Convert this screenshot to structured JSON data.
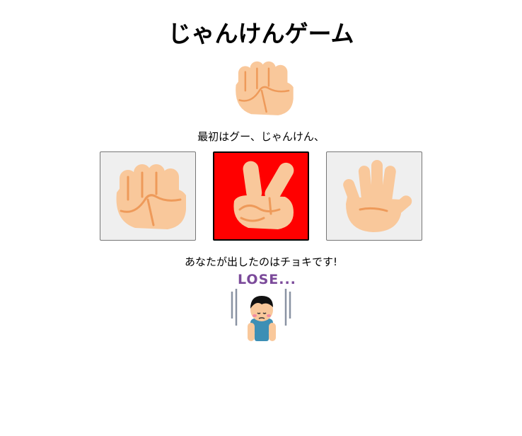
{
  "title": "じゃんけんゲーム",
  "computer_hand": {
    "icon": "rock-fist-icon"
  },
  "prompt_text": "最初はグー、じゃんけん、",
  "choices": [
    {
      "label": "グー",
      "icon": "rock-fist-icon",
      "selected": false
    },
    {
      "label": "チョキ",
      "icon": "scissors-peace-hand-icon",
      "selected": true
    },
    {
      "label": "パー",
      "icon": "paper-open-hand-icon",
      "selected": false
    }
  ],
  "result_text": "あなたが出したのはチョキです!",
  "outcome": {
    "text": "LOSE...",
    "color": "#7b4a9a",
    "icon": "sad-boy-bowing-icon"
  },
  "colors": {
    "selected_bg": "#ff0000",
    "button_bg": "#efefef",
    "skin": "#f9c89b",
    "skin_line": "#ee9a5a"
  }
}
